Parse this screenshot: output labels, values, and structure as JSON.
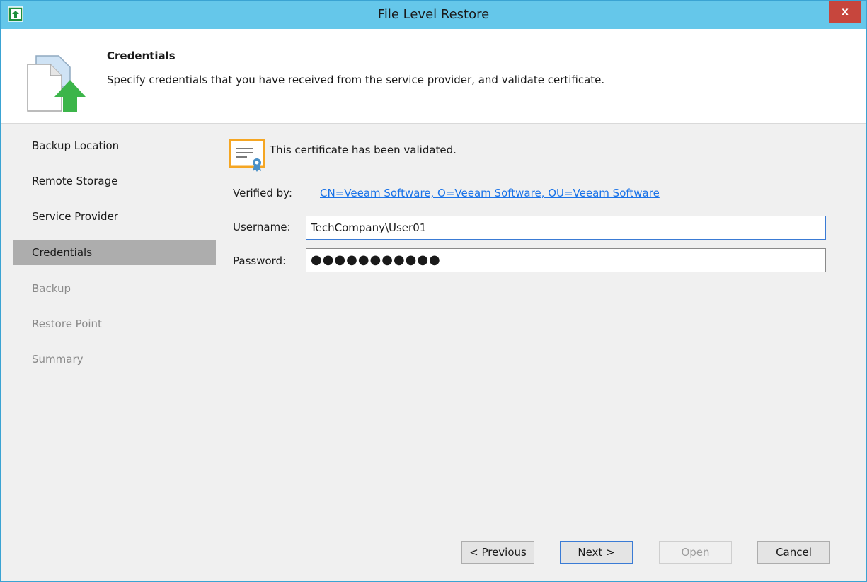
{
  "window": {
    "title": "File Level Restore",
    "close_label": "x"
  },
  "header": {
    "title": "Credentials",
    "description": "Specify credentials that you have received from the service provider, and validate certificate."
  },
  "sidebar": {
    "items": [
      {
        "label": "Backup Location",
        "state": "done"
      },
      {
        "label": "Remote Storage",
        "state": "done"
      },
      {
        "label": "Service Provider",
        "state": "done"
      },
      {
        "label": "Credentials",
        "state": "active"
      },
      {
        "label": "Backup",
        "state": "pending"
      },
      {
        "label": "Restore Point",
        "state": "pending"
      },
      {
        "label": "Summary",
        "state": "pending"
      }
    ]
  },
  "content": {
    "certificate_status": "This certificate has been validated.",
    "verified_by_label": "Verified by:",
    "verified_by_value": "CN=Veeam Software, O=Veeam Software, OU=Veeam Software",
    "username_label": "Username:",
    "username_value": "TechCompany\\User01",
    "password_label": "Password:",
    "password_value": "●●●●●●●●●●●"
  },
  "footer": {
    "previous_label": "< Previous",
    "next_label": "Next >",
    "open_label": "Open",
    "cancel_label": "Cancel"
  },
  "colors": {
    "titlebar": "#65c7ea",
    "close": "#c7463d",
    "link": "#1a73e8",
    "active_step": "#adadad",
    "accent_green": "#3cb54a",
    "cert_orange": "#f5a623"
  }
}
